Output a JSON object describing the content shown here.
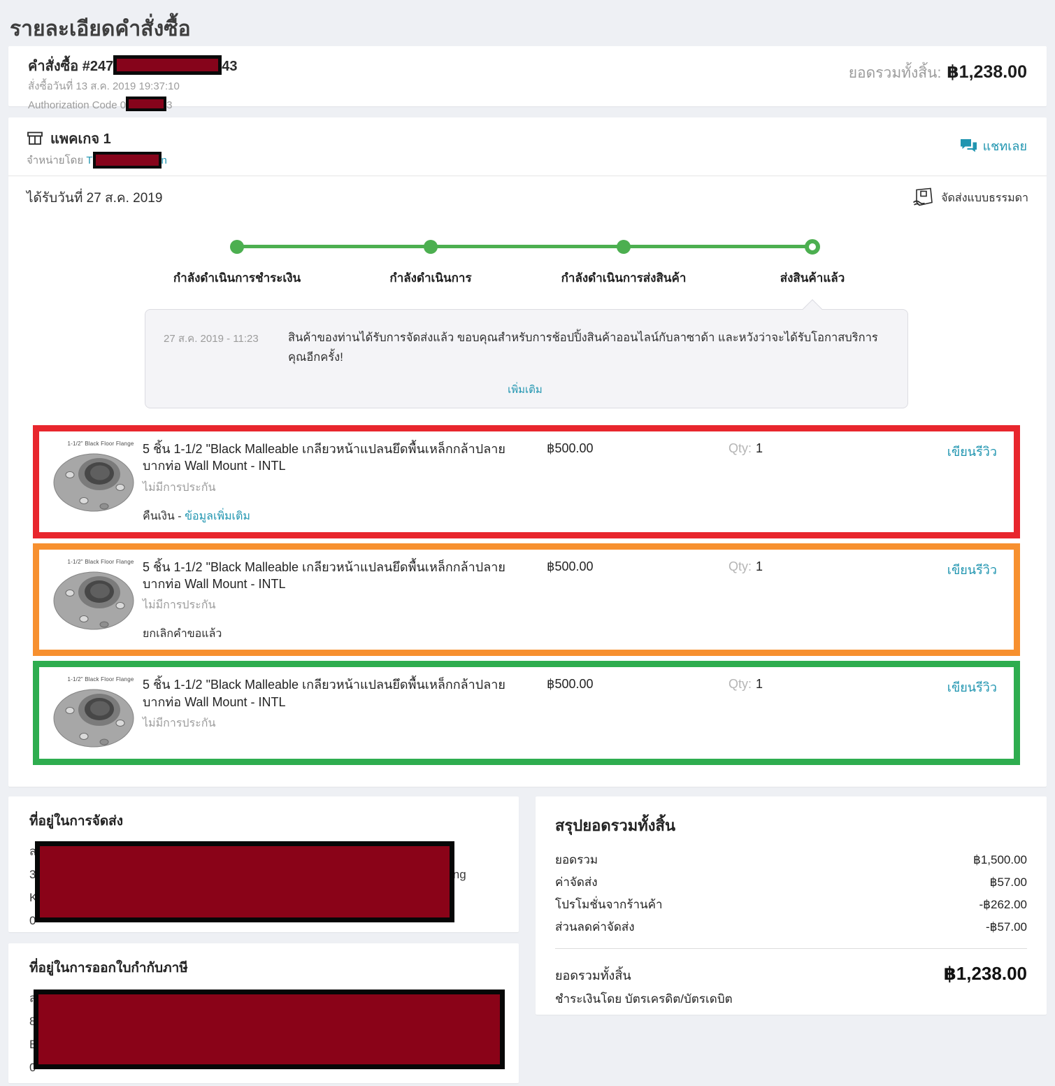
{
  "page": {
    "title": "รายละเอียดคำสั่งซื้อ"
  },
  "order_header": {
    "order_label_prefix": "คำสั่งซื้อ #247",
    "order_label_suffix": "43",
    "order_date": "สั่งซื้อวันที่ 13 ส.ค. 2019 19:37:10",
    "auth_code_prefix": "Authorization Code 0",
    "auth_code_suffix": "3",
    "grand_total_label": "ยอดรวมทั้งสิ้น:",
    "grand_total_value": "฿1,238.00"
  },
  "package": {
    "title": "แพคเกจ 1",
    "sold_by_label": "จำหน่ายโดย",
    "seller_prefix": "T",
    "seller_suffix": "n",
    "chat_link": "แชทเลย",
    "received_date": "ได้รับวันที่ 27 ส.ค. 2019",
    "delivery_type": "จัดส่งแบบธรรมดา"
  },
  "tracker": {
    "steps": [
      {
        "label": "กำลังดำเนินการชำระเงิน",
        "state": "done"
      },
      {
        "label": "กำลังดำเนินการ",
        "state": "done"
      },
      {
        "label": "กำลังดำเนินการส่งสินค้า",
        "state": "done"
      },
      {
        "label": "ส่งสินค้าแล้ว",
        "state": "current"
      }
    ]
  },
  "status_message": {
    "date": "27 ส.ค. 2019 - 11:23",
    "text": "สินค้าของท่านได้รับการจัดส่งแล้ว ขอบคุณสำหรับการช้อปปิ้งสินค้าออนไลน์กับลาซาด้า และหวังว่าจะได้รับโอกาสบริการคุณอีกครั้ง!",
    "more_link": "เพิ่มเติม"
  },
  "products": {
    "items": [
      {
        "image_caption": "1-1/2\" Black Floor Flange",
        "title": "5 ชิ้น 1-1/2 \"Black Malleable เกลียวหน้าแปลนยึดพื้นเหล็กกล้าปลายบากท่อ Wall Mount - INTL",
        "warranty": "ไม่มีการประกัน",
        "status_prefix": "คืนเงิน - ",
        "status_link": "ข้อมูลเพิ่มเติม",
        "price": "฿500.00",
        "qty_label": "Qty:",
        "qty": "1",
        "review_link": "เขียนรีวิว",
        "annotation_color": "#e8262d"
      },
      {
        "image_caption": "1-1/2\" Black Floor Flange",
        "title": "5 ชิ้น 1-1/2 \"Black Malleable เกลียวหน้าแปลนยึดพื้นเหล็กกล้าปลายบากท่อ Wall Mount - INTL",
        "warranty": "ไม่มีการประกัน",
        "status_text": "ยกเลิกคำขอแล้ว",
        "price": "฿500.00",
        "qty_label": "Qty:",
        "qty": "1",
        "review_link": "เขียนรีวิว",
        "annotation_color": "#f7902f"
      },
      {
        "image_caption": "1-1/2\" Black Floor Flange",
        "title": "5 ชิ้น 1-1/2 \"Black Malleable เกลียวหน้าแปลนยึดพื้นเหล็กกล้าปลายบากท่อ Wall Mount - INTL",
        "warranty": "ไม่มีการประกัน",
        "price": "฿500.00",
        "qty_label": "Qty:",
        "qty": "1",
        "review_link": "เขียนรีวิว",
        "annotation_color": "#2ead4f"
      }
    ]
  },
  "shipping_address": {
    "title": "ที่อยู่ในการจัดส่ง",
    "fragments": {
      "line1": "ส",
      "line2_start": "3",
      "line2_end": "Bang",
      "line3": "K",
      "line4": "0"
    }
  },
  "tax_address": {
    "title": "ที่อยู่ในการออกใบกำกับภาษี",
    "fragments": {
      "line1": "ส",
      "line2": "8",
      "line3": "B",
      "line4": "0"
    }
  },
  "summary": {
    "title": "สรุปยอดรวมทั้งสิ้น",
    "rows": [
      {
        "label": "ยอดรวม",
        "value": "฿1,500.00"
      },
      {
        "label": "ค่าจัดส่ง",
        "value": "฿57.00"
      },
      {
        "label": "โปรโมชั่นจากร้านค้า",
        "value": "-฿262.00"
      },
      {
        "label": "ส่วนลดค่าจัดส่ง",
        "value": "-฿57.00"
      }
    ],
    "total_label": "ยอดรวมทั้งสิ้น",
    "total_value": "฿1,238.00",
    "payment_method": "ชำระเงินโดย บัตรเครดิต/บัตรเดบิต"
  },
  "colors": {
    "link_teal": "#2095b0",
    "progress_green": "#4caf50",
    "annotation_red": "#e8262d",
    "annotation_orange": "#f7902f",
    "annotation_green": "#2ead4f",
    "redaction_fill": "#86041b"
  }
}
